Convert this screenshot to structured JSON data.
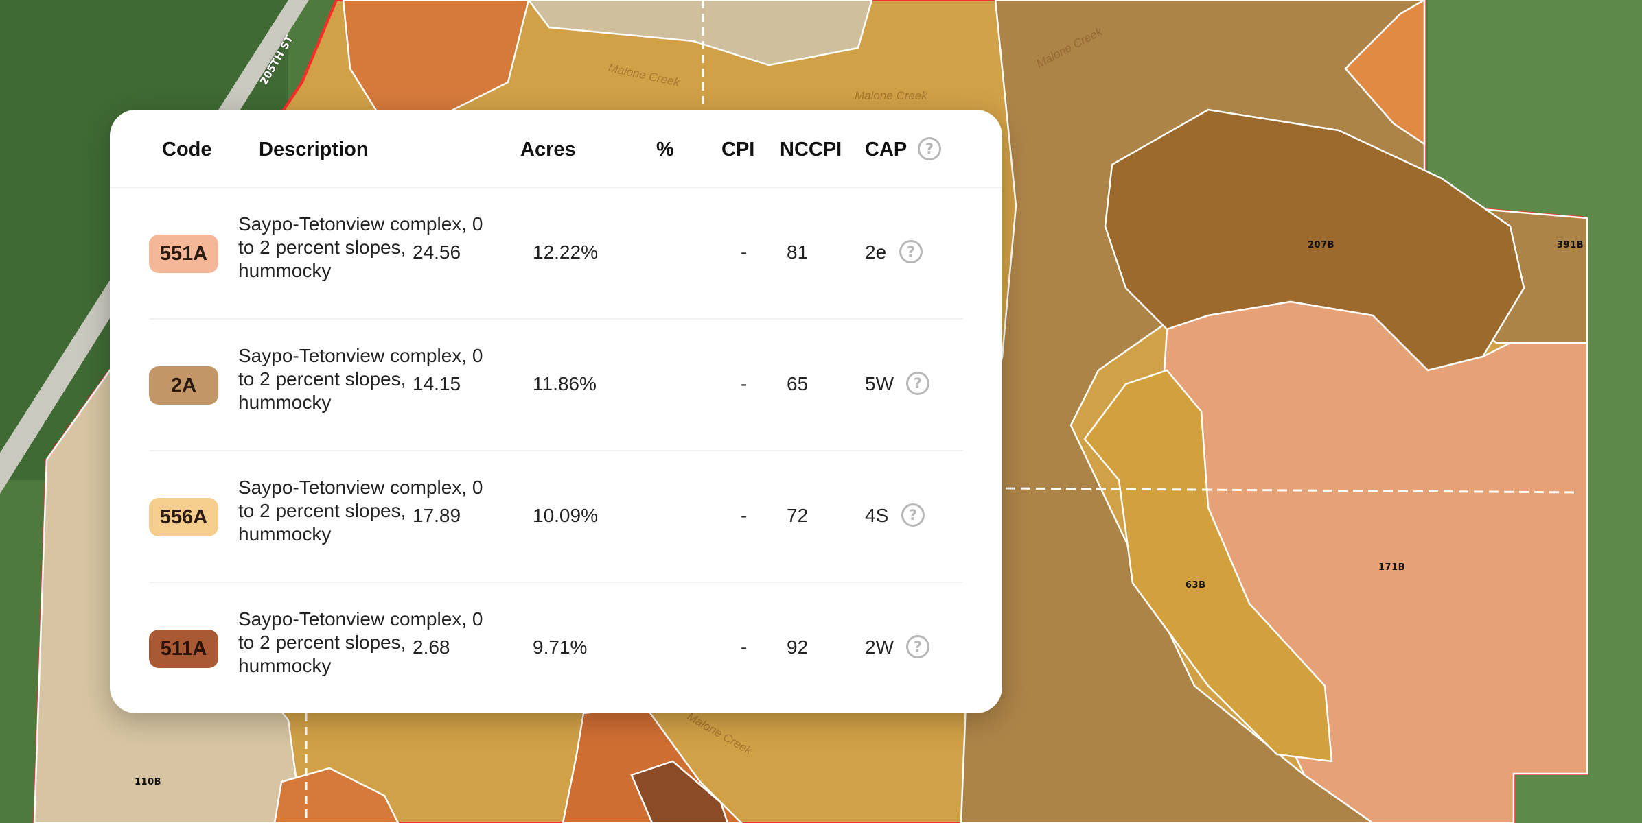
{
  "table": {
    "headers": {
      "code": "Code",
      "description": "Description",
      "acres": "Acres",
      "percent": "%",
      "cpi": "CPI",
      "nccpi": "NCCPI",
      "cap": "CAP"
    },
    "rows": [
      {
        "code": "551A",
        "color": "#f4b797",
        "text_color": "#2a1a10",
        "description": "Saypo-Tetonview complex, 0 to 2 percent slopes, hummocky",
        "acres": "24.56",
        "percent": "12.22%",
        "cpi": "-",
        "nccpi": "81",
        "cap": "2e"
      },
      {
        "code": "2A",
        "color": "#c29666",
        "text_color": "#2a1a10",
        "description": "Saypo-Tetonview complex, 0 to 2 percent slopes, hummocky",
        "acres": "14.15",
        "percent": "11.86%",
        "cpi": "-",
        "nccpi": "65",
        "cap": "5W"
      },
      {
        "code": "556A",
        "color": "#f5cd8d",
        "text_color": "#2a1a10",
        "description": "Saypo-Tetonview complex, 0 to 2 percent slopes, hummocky",
        "acres": "17.89",
        "percent": "10.09%",
        "cpi": "-",
        "nccpi": "72",
        "cap": "4S"
      },
      {
        "code": "511A",
        "color": "#a95a35",
        "text_color": "#2a1208",
        "description": "Saypo-Tetonview complex, 0 to 2 percent slopes, hummocky",
        "acres": "2.68",
        "percent": "9.71%",
        "cpi": "-",
        "nccpi": "92",
        "cap": "2W"
      }
    ]
  },
  "map": {
    "road_label": "205TH ST",
    "creek_label": "Malone Creek",
    "soil_labels": [
      "207B",
      "391B",
      "63B",
      "171B",
      "110B"
    ]
  },
  "icons": {
    "help": "question-circle-icon"
  }
}
